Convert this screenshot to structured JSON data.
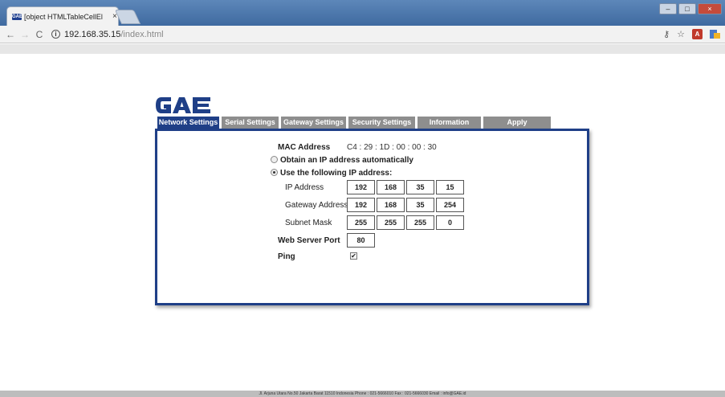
{
  "browser": {
    "tab_title": "[object HTMLTableCellEl",
    "tab_favicon": "GAE",
    "tab_close": "×",
    "url_host": "192.168.35.15",
    "url_path": "/index.html",
    "back": "←",
    "forward": "→",
    "reload": "C",
    "info": "i",
    "window_controls": {
      "minimize": "–",
      "maximize": "□",
      "close": "×"
    },
    "toolbar_icons": {
      "key": "⚷",
      "star": "☆",
      "pdf": "A"
    }
  },
  "logo": {
    "text": "GAE",
    "color": "#1f3f87"
  },
  "tabs": [
    {
      "label": "Network Settings",
      "active": true
    },
    {
      "label": "Serial Settings",
      "active": false
    },
    {
      "label": "Gateway Settings",
      "active": false
    },
    {
      "label": "Security Settings",
      "active": false
    },
    {
      "label": "Information",
      "active": false
    },
    {
      "label": "Apply",
      "active": false
    }
  ],
  "network": {
    "mac_label": "MAC Address",
    "mac_value": "C4 : 29 : 1D : 00 : 00 : 30",
    "option_auto": "Obtain an IP address automatically",
    "option_manual": "Use the following IP address:",
    "selected_option": "manual",
    "ip_label": "IP Address",
    "ip": [
      "192",
      "168",
      "35",
      "15"
    ],
    "gateway_label": "Gateway Address",
    "gateway": [
      "192",
      "168",
      "35",
      "254"
    ],
    "subnet_label": "Subnet Mask",
    "subnet": [
      "255",
      "255",
      "255",
      "0"
    ],
    "port_label": "Web Server Port",
    "port": "80",
    "ping_label": "Ping",
    "ping_checked": true,
    "check_mark": "✔"
  },
  "footer": {
    "text": "Jl. Arjuna Utara No.50 Jakarta Barat 11510 Indonesia Phone : 021-5666010 Fax : 021-5666030 Email : info@GAE.id"
  },
  "colors": {
    "accent": "#1f3f87",
    "inactive_tab": "#8e8e8e"
  }
}
